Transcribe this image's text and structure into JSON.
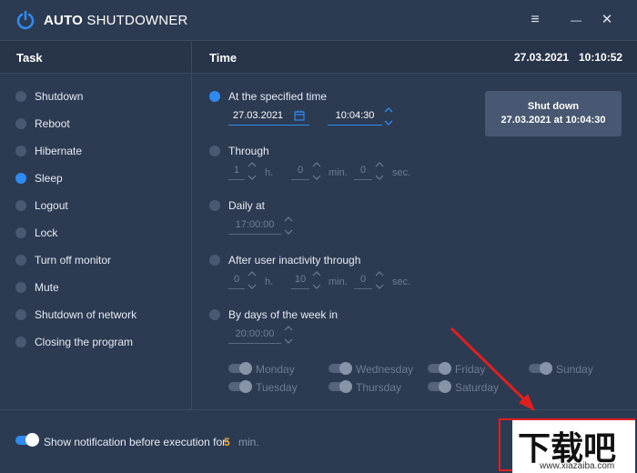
{
  "app": {
    "title_bold": "AUTO",
    "title_rest": " SHUTDOWNER",
    "menu_glyph": "≡",
    "minimize_glyph": "—",
    "close_glyph": "✕"
  },
  "header": {
    "task": "Task",
    "time": "Time",
    "date": "27.03.2021",
    "clock": "10:10:52"
  },
  "tasks": [
    {
      "label": "Shutdown",
      "selected": false
    },
    {
      "label": "Reboot",
      "selected": false
    },
    {
      "label": "Hibernate",
      "selected": false
    },
    {
      "label": "Sleep",
      "selected": true
    },
    {
      "label": "Logout",
      "selected": false
    },
    {
      "label": "Lock",
      "selected": false
    },
    {
      "label": "Turn off monitor",
      "selected": false
    },
    {
      "label": "Mute",
      "selected": false
    },
    {
      "label": "Shutdown of network",
      "selected": false
    },
    {
      "label": "Closing the program",
      "selected": false
    }
  ],
  "time_options": {
    "specified": {
      "label": "At the specified time",
      "selected": true,
      "date": "27.03.2021",
      "time": "10:04:30"
    },
    "through": {
      "label": "Through",
      "hours": "1",
      "minutes": "0",
      "seconds": "0"
    },
    "daily": {
      "label": "Daily at",
      "time": "17:00:00"
    },
    "inactivity": {
      "label": "After user inactivity through",
      "hours": "0",
      "minutes": "10",
      "seconds": "0"
    },
    "weekdays": {
      "label": "By days of the week in",
      "time": "20:00:00"
    }
  },
  "units": {
    "h": "h.",
    "min": "min.",
    "sec": "sec."
  },
  "days": [
    "Monday",
    "Tuesday",
    "Wednesday",
    "Thursday",
    "Friday",
    "Saturday",
    "Sunday"
  ],
  "shutdown_button": {
    "line1": "Shut down",
    "line2": "27.03.2021 at 10:04:30"
  },
  "notification": {
    "label": "Show notification before execution for:",
    "value": "5",
    "unit": "min.",
    "enabled": true
  },
  "watermark": {
    "text": "下载吧",
    "url": "www.xiazaiba.com"
  },
  "colors": {
    "background": "#2c3a52",
    "accent": "#2f8bf0",
    "highlight": "#f5a623",
    "annotation": "#e02020"
  }
}
